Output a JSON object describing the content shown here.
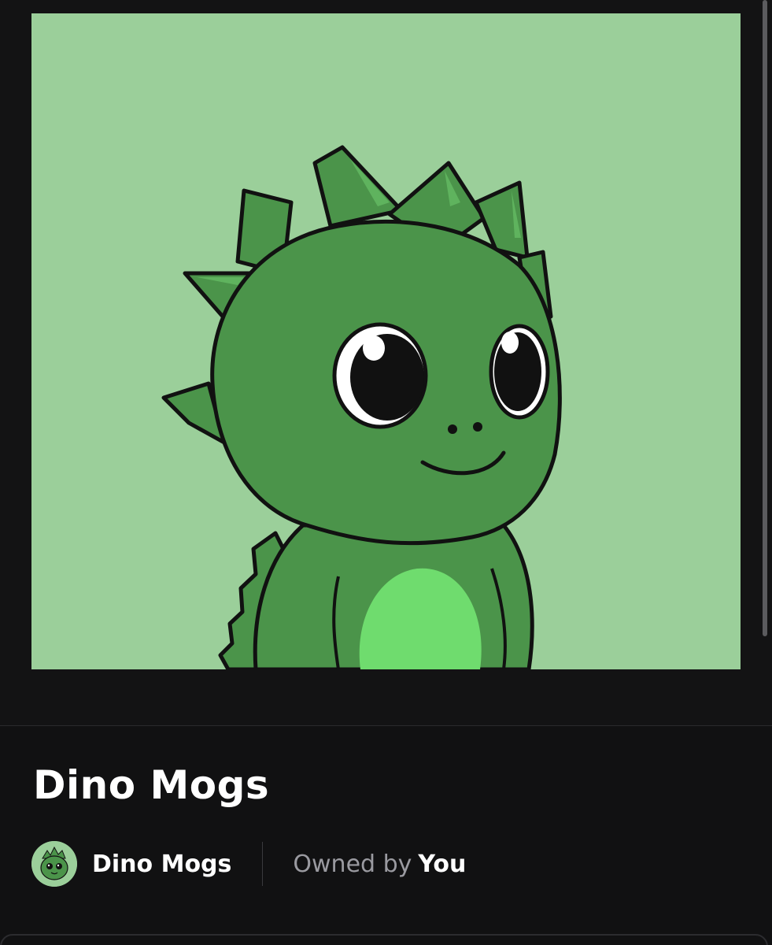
{
  "nft": {
    "title": "Dino Mogs",
    "image_subject": "green-dino-character",
    "background_color": "#9bcf9a"
  },
  "collection": {
    "name": "Dino Mogs",
    "avatar_icon": "dino-avatar"
  },
  "ownership": {
    "prefix": "Owned by",
    "owner": "You"
  },
  "colors": {
    "page_bg": "#111112",
    "art_bg": "#9bcf9a",
    "dino_body": "#4b944a",
    "dino_belly": "#6fdc6e",
    "text_primary": "#ffffff",
    "text_secondary": "#9a9aa0"
  }
}
